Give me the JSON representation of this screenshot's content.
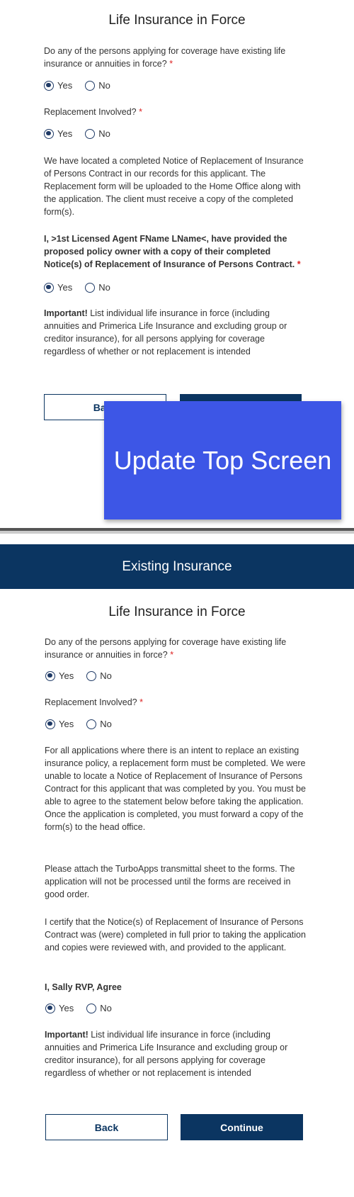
{
  "top": {
    "title": "Life Insurance in Force",
    "q1": {
      "text": "Do any of the persons applying for coverage have existing life insurance or annuities in force?",
      "required": "*",
      "yes": "Yes",
      "no": "No",
      "selected": "Yes"
    },
    "q2": {
      "text": "Replacement Involved?",
      "required": "*",
      "yes": "Yes",
      "no": "No",
      "selected": "Yes"
    },
    "notice": "We have located a completed Notice of Replacement of Insurance of Persons Contract in our records for this applicant.  The Replacement form will be uploaded to the Home Office along with the application.  The client must receive a copy of the completed form(s).",
    "agent_statement": "I, >1st Licensed Agent FName LName<, have provided the proposed policy owner with a copy of their completed Notice(s) of Replacement of Insurance of Persons Contract.",
    "agent_required": "*",
    "q3": {
      "yes": "Yes",
      "no": "No",
      "selected": "Yes"
    },
    "important_label": "Important!",
    "important_text": " List individual life insurance in force (including annuities and Primerica Life Insurance and excluding group or creditor insurance), for all persons applying for coverage regardless of whether or not replacement is intended",
    "back_label": "Back",
    "overlay_text": "Update Top Screen"
  },
  "bottom": {
    "header": "Existing Insurance",
    "title": "Life Insurance in Force",
    "q1": {
      "text": "Do any of the persons applying for coverage have existing life insurance or annuities in force?",
      "required": "*",
      "yes": "Yes",
      "no": "No",
      "selected": "Yes"
    },
    "q2": {
      "text": "Replacement Involved?",
      "required": "*",
      "yes": "Yes",
      "no": "No",
      "selected": "Yes"
    },
    "para1": "For all applications where there is an intent to replace an existing insurance policy, a replacement form must be completed.  We were unable to locate a Notice of Replacement of Insurance of Persons Contract for this applicant that was completed by you.  You must be able to agree to the statement below before taking the application.  Once the application is completed, you must forward a copy of the form(s) to the head office.",
    "para2": "Please attach the TurboApps transmittal sheet to the forms. The application will not be processed until the forms are received in good order.",
    "para3": "I certify that the Notice(s) of Replacement of Insurance of Persons Contract was (were) completed in full prior to taking the application and copies were reviewed with, and provided to the applicant.",
    "agree_label": "I, Sally RVP, Agree",
    "q3": {
      "yes": "Yes",
      "no": "No",
      "selected": "Yes"
    },
    "important_label": "Important!",
    "important_text": " List individual life insurance in force (including annuities and Primerica Life Insurance and excluding group or creditor insurance), for all persons applying for coverage regardless of whether or not replacement is intended",
    "back_label": "Back",
    "continue_label": "Continue"
  },
  "colors": {
    "primary": "#0b3561",
    "overlay": "#3d56e6",
    "required": "#dd2222"
  }
}
